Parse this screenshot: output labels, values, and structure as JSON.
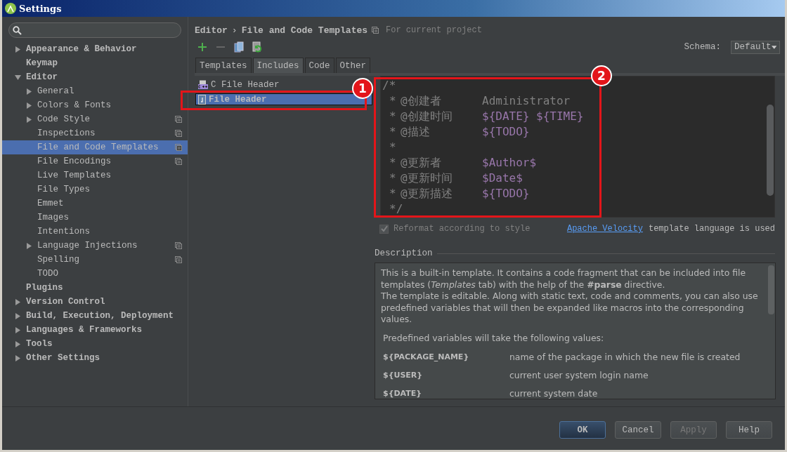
{
  "window": {
    "title": "Settings"
  },
  "sidebar": {
    "items": [
      {
        "label": "Appearance & Behavior",
        "kind": "collapsed",
        "selected": false,
        "project_scope": false
      },
      {
        "label": "Keymap",
        "kind": "leaf",
        "selected": false,
        "project_scope": false
      },
      {
        "label": "Editor",
        "kind": "expanded",
        "selected": false,
        "project_scope": false,
        "children": [
          {
            "label": "General",
            "kind": "collapsed",
            "selected": false,
            "project_scope": false
          },
          {
            "label": "Colors & Fonts",
            "kind": "collapsed",
            "selected": false,
            "project_scope": false
          },
          {
            "label": "Code Style",
            "kind": "collapsed",
            "selected": false,
            "project_scope": true
          },
          {
            "label": "Inspections",
            "kind": "leaf",
            "selected": false,
            "project_scope": true
          },
          {
            "label": "File and Code Templates",
            "kind": "leaf",
            "selected": true,
            "project_scope": true
          },
          {
            "label": "File Encodings",
            "kind": "leaf",
            "selected": false,
            "project_scope": true
          },
          {
            "label": "Live Templates",
            "kind": "leaf",
            "selected": false,
            "project_scope": false
          },
          {
            "label": "File Types",
            "kind": "leaf",
            "selected": false,
            "project_scope": false
          },
          {
            "label": "Emmet",
            "kind": "leaf",
            "selected": false,
            "project_scope": false
          },
          {
            "label": "Images",
            "kind": "leaf",
            "selected": false,
            "project_scope": false
          },
          {
            "label": "Intentions",
            "kind": "leaf",
            "selected": false,
            "project_scope": false
          },
          {
            "label": "Language Injections",
            "kind": "collapsed",
            "selected": false,
            "project_scope": true
          },
          {
            "label": "Spelling",
            "kind": "leaf",
            "selected": false,
            "project_scope": true
          },
          {
            "label": "TODO",
            "kind": "leaf",
            "selected": false,
            "project_scope": false
          }
        ]
      },
      {
        "label": "Plugins",
        "kind": "leaf",
        "selected": false,
        "project_scope": false
      },
      {
        "label": "Version Control",
        "kind": "collapsed",
        "selected": false,
        "project_scope": false
      },
      {
        "label": "Build, Execution, Deployment",
        "kind": "collapsed",
        "selected": false,
        "project_scope": false
      },
      {
        "label": "Languages & Frameworks",
        "kind": "collapsed",
        "selected": false,
        "project_scope": false
      },
      {
        "label": "Tools",
        "kind": "collapsed",
        "selected": false,
        "project_scope": false
      },
      {
        "label": "Other Settings",
        "kind": "collapsed",
        "selected": false,
        "project_scope": false
      }
    ]
  },
  "breadcrumb": {
    "parts": [
      "Editor",
      "File and Code Templates"
    ],
    "separator": "›",
    "scope": "For current project"
  },
  "schema": {
    "label": "Schema:",
    "value": "Default"
  },
  "tabs": [
    {
      "label": "Templates",
      "selected": false
    },
    {
      "label": "Includes",
      "selected": true
    },
    {
      "label": "Code",
      "selected": false
    },
    {
      "label": "Other",
      "selected": false
    }
  ],
  "templates": [
    {
      "name": "C File Header",
      "kind": "cpp",
      "selected": false
    },
    {
      "name": "File Header",
      "kind": "java",
      "selected": true
    }
  ],
  "editor": {
    "lines": [
      {
        "lead": "/*"
      },
      {
        "lead": "*",
        "tag": "@创建者",
        "value": [
          {
            "text": "Administrator",
            "kind": "comment"
          }
        ]
      },
      {
        "lead": "*",
        "tag": "@创建时间",
        "value": [
          {
            "text": "${DATE} ${TIME}",
            "kind": "variable"
          }
        ]
      },
      {
        "lead": "*",
        "tag": "@描述",
        "value": [
          {
            "text": "${TODO}",
            "kind": "variable"
          }
        ]
      },
      {
        "lead": "*"
      },
      {
        "lead": "*",
        "tag": "@更新者",
        "value": [
          {
            "text": "$Author$",
            "kind": "variable"
          }
        ]
      },
      {
        "lead": "*",
        "tag": "@更新时间",
        "value": [
          {
            "text": "$Date$",
            "kind": "variable"
          }
        ]
      },
      {
        "lead": "*",
        "tag": "@更新描述",
        "value": [
          {
            "text": "${TODO}",
            "kind": "variable"
          }
        ]
      },
      {
        "lead": "*/"
      }
    ]
  },
  "reformat": {
    "label": "Reformat according to style",
    "checked": true,
    "disabled": true
  },
  "language_note": {
    "link": "Apache Velocity",
    "text": "template language is used"
  },
  "description": {
    "title": "Description",
    "paragraphs": [
      "This is a built-in template. It contains a code fragment that can be included into file templates (*Templates* tab) with the help of the **#parse** directive.",
      "The template is editable. Along with static text, code and comments, you can also use predefined variables that will then be expanded like macros into the corresponding values."
    ],
    "variables_intro": "Predefined variables will take the following values:",
    "variables": [
      {
        "name": "${PACKAGE_NAME}",
        "meaning": "name of the package in which the new file is created"
      },
      {
        "name": "${USER}",
        "meaning": "current user system login name"
      },
      {
        "name": "${DATE}",
        "meaning": "current system date"
      }
    ]
  },
  "buttons": [
    {
      "label": "OK",
      "default": true,
      "disabled": false
    },
    {
      "label": "Cancel",
      "default": false,
      "disabled": false
    },
    {
      "label": "Apply",
      "default": false,
      "disabled": true
    },
    {
      "label": "Help",
      "default": false,
      "disabled": false
    }
  ],
  "callouts": [
    {
      "label": "1"
    },
    {
      "label": "2"
    }
  ]
}
